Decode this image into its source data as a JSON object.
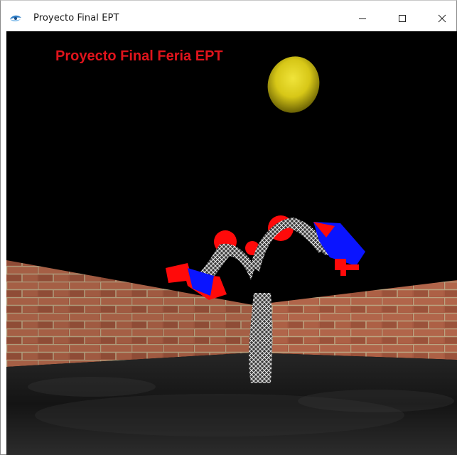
{
  "window": {
    "title": "Proyecto Final EPT",
    "icon": "app-eye-icon"
  },
  "controls": {
    "minimize_icon": "minimize-icon",
    "maximize_icon": "maximize-icon",
    "close_icon": "close-icon"
  },
  "scene": {
    "overlay_title": "Proyecto Final Feria EPT",
    "colors": {
      "title": "#e0141c",
      "sky": "#000000",
      "brick": "#b8654a",
      "mortar": "#c9b58e",
      "floor": "#1c1c1c",
      "sun": "#e1d21a",
      "robot_red": "#ff0a0a",
      "robot_blue": "#0a14ff"
    }
  }
}
